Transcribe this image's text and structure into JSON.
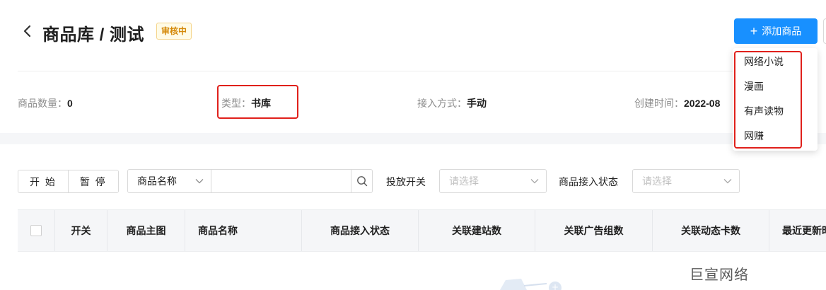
{
  "header": {
    "title": "商品库 / 测试",
    "status_badge": "审核中",
    "add_button_label": "添加商品"
  },
  "info": {
    "count_label": "商品数量：",
    "count_value": "0",
    "type_label": "类型：",
    "type_value": "书库",
    "access_label": "接入方式：",
    "access_value": "手动",
    "created_label": "创建时间：",
    "created_value": "2022-08"
  },
  "toolbar": {
    "start_label": "开 始",
    "pause_label": "暂 停",
    "search_field_select": "商品名称",
    "search_placeholder": "",
    "delivery_switch_label": "投放开关",
    "delivery_switch_placeholder": "请选择",
    "access_status_label": "商品接入状态",
    "access_status_placeholder": "请选择"
  },
  "table": {
    "columns": [
      "开关",
      "商品主图",
      "商品名称",
      "商品接入状态",
      "关联建站数",
      "关联广告组数",
      "关联动态卡数",
      "最近更新时间"
    ]
  },
  "dropdown": {
    "items": [
      "网络小说",
      "漫画",
      "有声读物",
      "网赚"
    ]
  },
  "watermark": "巨宣网络",
  "colors": {
    "primary": "#1890ff",
    "highlight_box": "#e0201b",
    "badge_text": "#d48806"
  },
  "icons": {
    "back": "chevron-left-icon",
    "search": "search-icon",
    "select_arrow": "chevron-down-icon",
    "add": "plus-icon"
  }
}
